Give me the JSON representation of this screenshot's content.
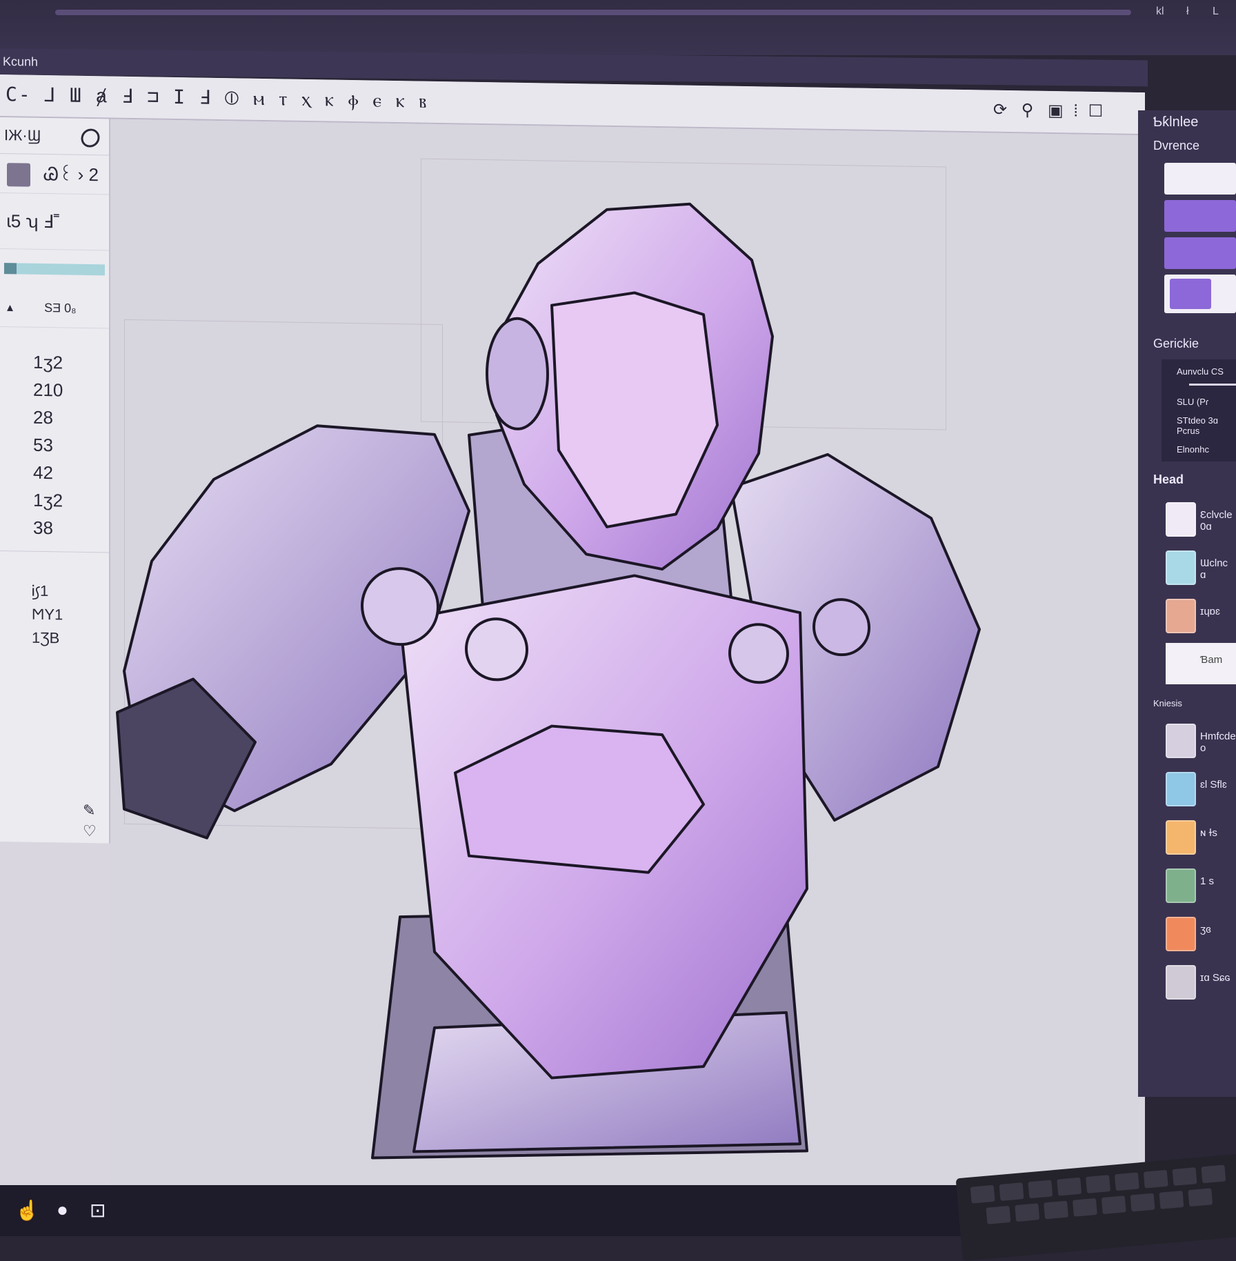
{
  "window": {
    "title": "Kcunh",
    "top_controls": [
      "kl",
      "ł",
      "L"
    ]
  },
  "toolbar": {
    "tools_text": "C- ⅃ Ш ⱥ Ⅎ  ⊐ Ι Ⅎ ⦶ ⲙ ⲧ ⲭ ⲕ ⲫ ⲉ ⲕ ⲃ",
    "right_icons": [
      "lasso-icon",
      "pin-icon",
      "frame-icon",
      "layer-icon",
      "square-icon"
    ]
  },
  "left_panel": {
    "header": "IЖ·Ϣ",
    "brush_label": "Ꮚ꒰ › 2",
    "size_label": "ɩ5 ʮ Ⅎ˭",
    "opacity_label": "SƎ 0₈",
    "values": [
      "1ʒ2",
      "210",
      "28",
      "53",
      "42",
      "1ʒ2",
      "38"
    ],
    "sub_values": [
      "Ꭵ꠹1",
      "ϺΥ1",
      "1ƷB"
    ]
  },
  "right_panel": {
    "title": "Ƅƙlnlee",
    "section_1": "Dvrence",
    "section_2": "Gerickie",
    "section_2_items": [
      "Aunvclu CS",
      "SLU (Pɾ",
      "STtdeo 3ɑ Pcrus",
      "Elnonhc"
    ],
    "section_3": "Head",
    "layers": [
      {
        "name": "Ɛclvcle 0ɑ",
        "color": "#f0e9f6"
      },
      {
        "name": "Ɯclnc ɑ",
        "color": "#a9d9e6"
      },
      {
        "name": "ɪɥɒɛ",
        "color": "#e6a891"
      },
      {
        "name": "Ɓam",
        "color": "#ffffff"
      }
    ],
    "section_4": "Kniesis",
    "layers_2": [
      {
        "name": "Hmfcde o",
        "color": "#d6cfe0"
      },
      {
        "name": "ɛl Sflɛ",
        "color": "#8fc7e6"
      },
      {
        "name": "ɴ ɫs",
        "color": "#f4b66c"
      },
      {
        "name": "1 s",
        "color": "#7fb08c"
      },
      {
        "name": "ʒɞ",
        "color": "#f08a5d"
      },
      {
        "name": "ɪɑ Sɕɢ",
        "color": "#cfcad6"
      }
    ]
  },
  "colors": {
    "accent": "#8d68d8",
    "armor_light": "#e2cdf0",
    "armor_mid": "#b99ee0",
    "armor_dark": "#6c5a92",
    "outline": "#1c1726"
  }
}
